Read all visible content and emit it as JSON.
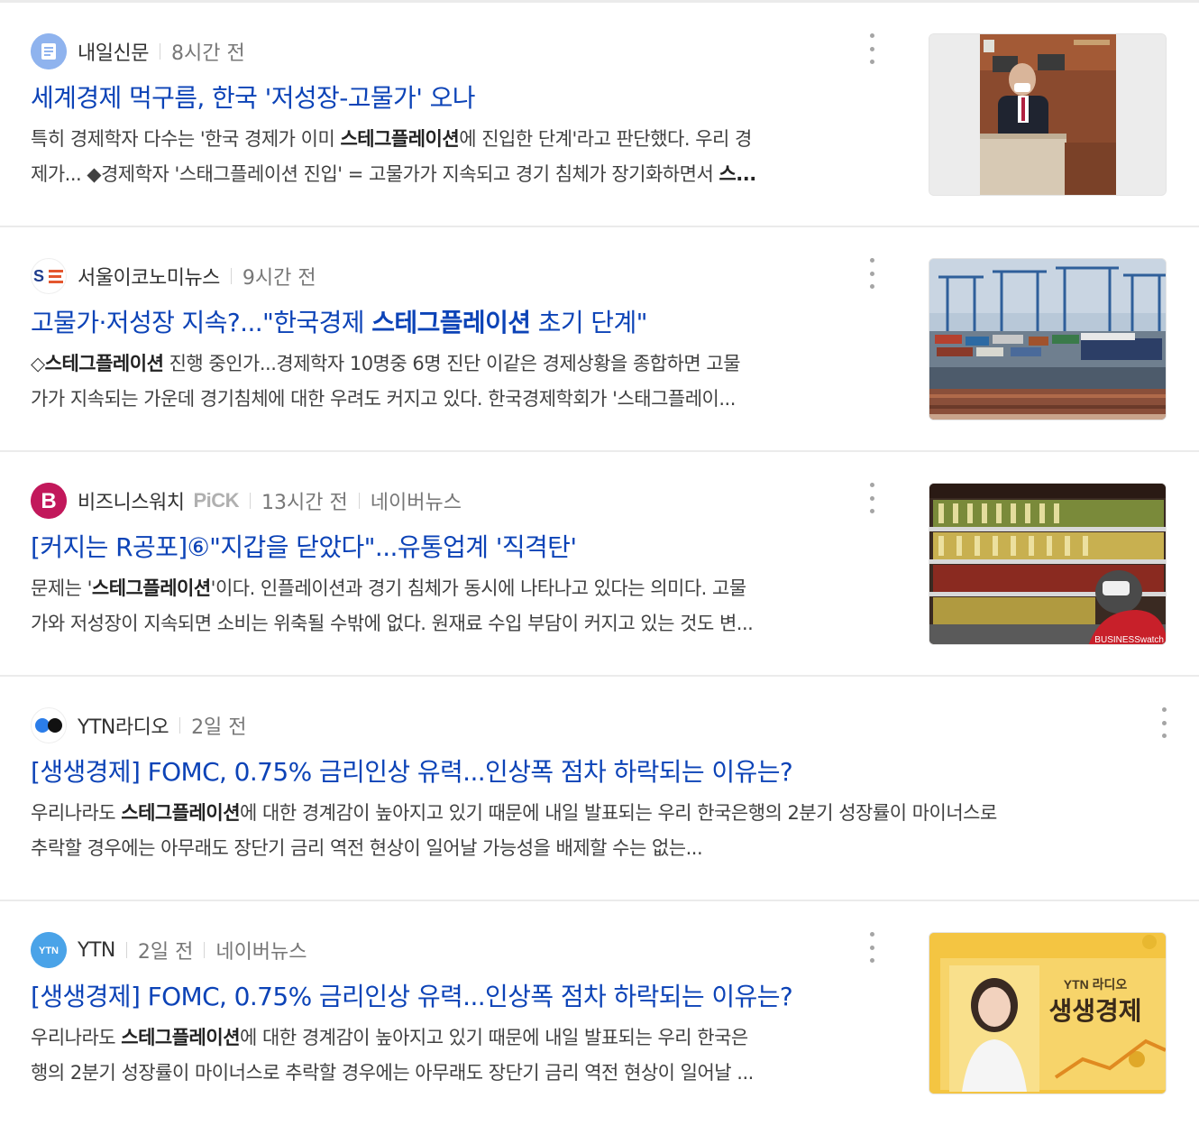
{
  "results": [
    {
      "source": "내일신문",
      "time": "8시간 전",
      "title": "세계경제 먹구름, 한국 '저성장-고물가' 오나",
      "desc_l1_a": "특히 경제학자 다수는 '한국 경제가 이미 ",
      "desc_l1_b": "스테그플레이션",
      "desc_l1_c": "에 진입한 단계'라고 판단했다. 우리 경",
      "desc_l2_a": "제가... ◆경제학자 '스태그플레이션 진입' = 고물가가 지속되고 경기 침체가 장기화하면서 ",
      "desc_l2_b": "스...",
      "logo_icon": "document-icon"
    },
    {
      "source": "서울이코노미뉴스",
      "time": "9시간 전",
      "title_a": "고물가·저성장 지속?...\"한국경제 ",
      "title_b": "스테그플레이션",
      "title_c": " 초기 단계\"",
      "desc_l1_a": "◇",
      "desc_l1_b": "스테그플레이션",
      "desc_l1_c": " 진행 중인가...경제학자 10명중 6명 진단 이같은 경제상황을 종합하면 고물",
      "desc_l2": "가가 지속되는 가운데 경기침체에 대한 우려도 커지고 있다. 한국경제학회가 '스태그플레이..."
    },
    {
      "source": "비즈니스워치",
      "pick": "PiCK",
      "time": "13시간 전",
      "extra": "네이버뉴스",
      "title": "[커지는 R공포]⑥\"지갑을 닫았다\"...유통업계 '직격탄'",
      "desc_l1_a": "문제는 '",
      "desc_l1_b": "스테그플레이션",
      "desc_l1_c": "'이다. 인플레이션과 경기 침체가 동시에 나타나고 있다는 의미다. 고물",
      "desc_l2": "가와 저성장이 지속되면 소비는 위축될 수밖에 없다. 원재료 수입 부담이 커지고 있는 것도 변...",
      "watermark": "BUSINESSwatch"
    },
    {
      "source": "YTN라디오",
      "time": "2일 전",
      "title": "[생생경제] FOMC, 0.75% 금리인상 유력...인상폭 점차 하락되는 이유는?",
      "desc_l1_a": "우리나라도 ",
      "desc_l1_b": "스테그플레이션",
      "desc_l1_c": "에 대한 경계감이 높아지고 있기 때문에 내일 발표되는 우리 한국은행의 2분기 성장률이 마이너스로",
      "desc_l2": "추락할 경우에는 아무래도 장단기 금리 역전 현상이 일어날 가능성을 배제할 수는 없는..."
    },
    {
      "source": "YTN",
      "logo_text": "YTN",
      "time": "2일 전",
      "extra": "네이버뉴스",
      "title": "[생생경제] FOMC, 0.75% 금리인상 유력...인상폭 점차 하락되는 이유는?",
      "desc_l1_a": "우리나라도 ",
      "desc_l1_b": "스테그플레이션",
      "desc_l1_c": "에 대한 경계감이 높아지고 있기 때문에 내일 발표되는 우리 한국은",
      "desc_l2": "행의 2분기 성장률이 마이너스로 추락할 경우에는 아무래도 장단기 금리 역전 현상이 일어날 ...",
      "thumb_brand": "YTN 라디오",
      "thumb_title": "생생경제"
    }
  ],
  "colors": {
    "title": "#0c43b7",
    "meta": "#777777",
    "divider": "#ebebeb"
  }
}
